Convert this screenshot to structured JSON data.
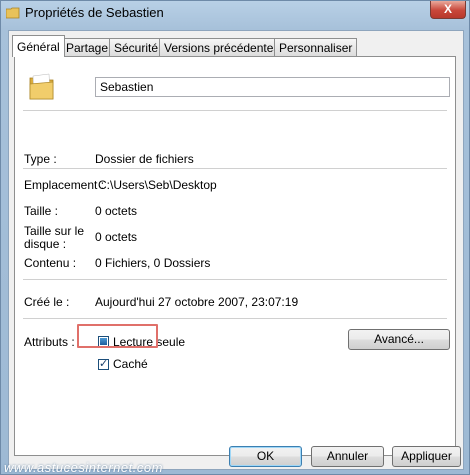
{
  "window": {
    "title": "Propriétés de Sebastien",
    "close_label": "X"
  },
  "tabs": [
    {
      "label": "Général",
      "active": true
    },
    {
      "label": "Partage"
    },
    {
      "label": "Sécurité"
    },
    {
      "label": "Versions précédentes"
    },
    {
      "label": "Personnaliser"
    }
  ],
  "general": {
    "name": "Sebastien",
    "type_label": "Type :",
    "type_value": "Dossier de fichiers",
    "location_label": "Emplacement :",
    "location_value": "C:\\Users\\Seb\\Desktop",
    "size_label": "Taille :",
    "size_value": "0 octets",
    "size_on_disk_label_1": "Taille sur le",
    "size_on_disk_label_2": "disque :",
    "size_on_disk_value": "0 octets",
    "contents_label": "Contenu :",
    "contents_value": "0 Fichiers, 0 Dossiers",
    "created_label": "Créé le :",
    "created_value": "Aujourd'hui 27 octobre 2007, 23:07:19",
    "attributes_label": "Attributs :",
    "readonly_label": "Lecture seule",
    "hidden_label": "Caché",
    "advanced_label": "Avancé..."
  },
  "buttons": {
    "ok": "OK",
    "cancel": "Annuler",
    "apply": "Appliquer"
  },
  "watermark": "www.astucesinternet.com",
  "colors": {
    "highlight": "#e0706a",
    "title_bar": "#a7c1da"
  }
}
